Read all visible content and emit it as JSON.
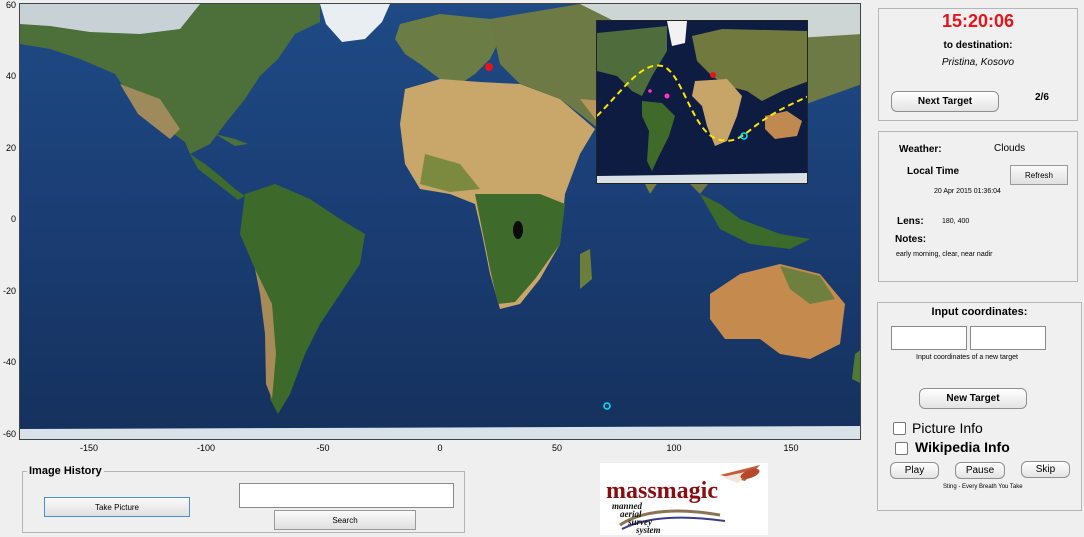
{
  "map": {
    "y_ticks": [
      "60",
      "40",
      "20",
      "0",
      "-20",
      "-40",
      "-60"
    ],
    "x_ticks": [
      "-150",
      "-100",
      "-50",
      "0",
      "50",
      "100",
      "150"
    ]
  },
  "destination": {
    "countdown": "15:20:06",
    "label": "to destination:",
    "place": "Pristina, Kosovo",
    "next_label": "Next Target",
    "progress": "2/6"
  },
  "info": {
    "weather_label": "Weather:",
    "weather_value": "Clouds",
    "local_time_label": "Local Time",
    "refresh_label": "Refresh",
    "datetime": "20 Apr 2015 01:36:04",
    "lens_label": "Lens:",
    "lens_value": "180, 400",
    "notes_label": "Notes:",
    "notes_value": "early morning, clear, near nadir"
  },
  "coords": {
    "title": "Input coordinates:",
    "hint": "Input coordinates of a new target",
    "lat_value": "",
    "lon_value": "",
    "new_target_label": "New Target",
    "picture_info_label": "Picture Info",
    "wikipedia_info_label": "Wikipedia Info",
    "play_label": "Play",
    "pause_label": "Pause",
    "skip_label": "Skip",
    "song": "Sting - Every Breath You Take"
  },
  "history": {
    "title": "Image History",
    "take_picture_label": "Take Picture",
    "search_value": "",
    "search_label": "Search"
  },
  "logo": {
    "brand": "massmagic",
    "tag1": "manned",
    "tag2": "aerial",
    "tag3": "survey",
    "tag4": "system"
  },
  "colors": {
    "countdown": "#e8141c",
    "target_marker": "#e8141c",
    "iss_marker": "#00e5ff",
    "track": "#ffe600",
    "logo_red": "#8b0d10"
  }
}
